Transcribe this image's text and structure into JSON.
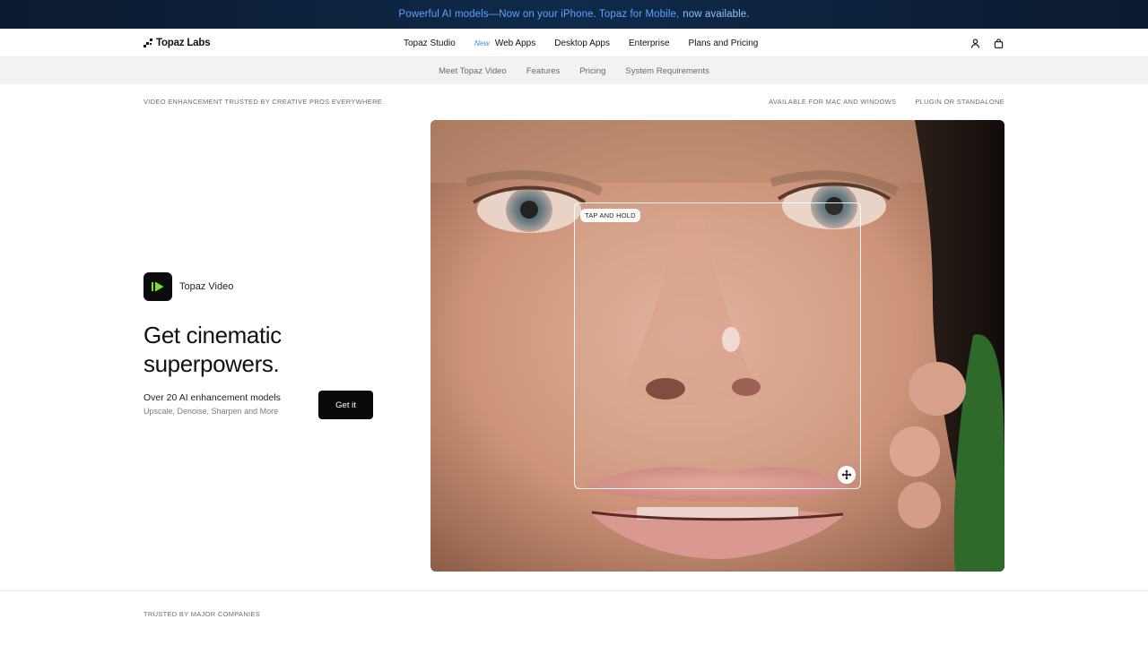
{
  "announcement": {
    "text_main": "Powerful AI models—Now on your iPhone. Topaz for Mobile,",
    "text_link": "now available."
  },
  "nav": {
    "logo_text": "Topaz Labs",
    "links": [
      {
        "label": "Topaz Studio"
      },
      {
        "badge": "New",
        "label": "Web Apps"
      },
      {
        "label": "Desktop Apps"
      },
      {
        "label": "Enterprise"
      },
      {
        "label": "Plans and Pricing"
      }
    ],
    "icons": [
      "user-icon",
      "shopping-bag-icon"
    ]
  },
  "subnav": {
    "items": [
      "Meet Topaz Video",
      "Features",
      "Pricing",
      "System Requirements"
    ]
  },
  "taglines": {
    "left": "VIDEO ENHANCEMENT TRUSTED BY CREATIVE PROS EVERYWHERE.",
    "right": [
      "AVAILABLE FOR MAC AND WINDOWS",
      "PLUGIN OR STANDALONE"
    ]
  },
  "hero": {
    "product_name": "Topaz Video",
    "headline": "Get cinematic superpowers.",
    "feature_title": "Over 20 AI enhancement models",
    "feature_subtitle": "Upscale, Denoise, Sharpen and More",
    "cta_label": "Get it",
    "compare_label": "TAP AND HOLD"
  },
  "footer": {
    "trusted_label": "TRUSTED BY MAJOR COMPANIES"
  },
  "colors": {
    "announce_bg": "#0f2a4a",
    "announce_text": "#5aa2ff",
    "accent_green": "#7ee321",
    "cta_bg": "#0a0a0a",
    "subnav_bg": "#f3f2f0"
  }
}
